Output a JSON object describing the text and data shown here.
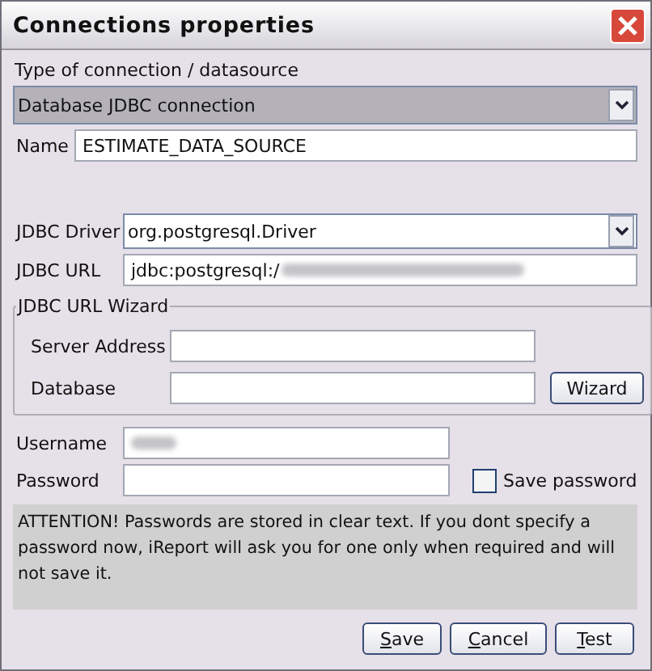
{
  "window": {
    "title": "Connections properties"
  },
  "type_label": "Type of connection / datasource",
  "type_combo": {
    "value": "Database JDBC connection"
  },
  "name": {
    "label": "Name",
    "value": "ESTIMATE_DATA_SOURCE"
  },
  "jdbc_driver": {
    "label": "JDBC Driver",
    "value": "org.postgresql.Driver"
  },
  "jdbc_url": {
    "label": "JDBC URL",
    "value": "jdbc:postgresql:/"
  },
  "wizard": {
    "title": "JDBC URL Wizard",
    "server_label": "Server Address",
    "database_label": "Database",
    "button": "Wizard"
  },
  "username": {
    "label": "Username"
  },
  "password": {
    "label": "Password"
  },
  "save_password": {
    "label": "Save password",
    "checked": false
  },
  "attention": "ATTENTION! Passwords are stored in clear text. If you dont specify a password now, iReport will ask you for one only when required and will not save it.",
  "buttons": [
    "Save",
    "Cancel",
    "Test"
  ]
}
